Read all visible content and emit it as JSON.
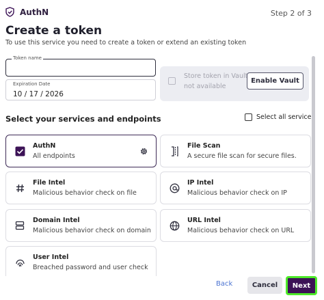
{
  "header": {
    "brand": "AuthN",
    "step": "Step 2 of 3"
  },
  "page": {
    "title": "Create a token",
    "subtitle": "To use this service you need to create a token or extend an existing token"
  },
  "form": {
    "token_name_label": "Token name",
    "token_name_value": "",
    "expiration_label": "Expiration Date",
    "expiration_value": "10 / 17 / 2026",
    "store_token_text": "Store token in Vault not available",
    "enable_vault_label": "Enable Vault"
  },
  "services": {
    "section_title": "Select your services and endpoints",
    "select_all_label": "Select all services",
    "items": [
      {
        "name": "AuthN",
        "desc": "All endpoints",
        "icon": "check-square-icon",
        "selected": true
      },
      {
        "name": "File Scan",
        "desc": "A secure file scan for secure files.",
        "icon": "file-scan-icon",
        "selected": false
      },
      {
        "name": "File Intel",
        "desc": "Malicious behavior check on file",
        "icon": "hash-icon",
        "selected": false
      },
      {
        "name": "IP Intel",
        "desc": "Malicious behavior check on IP",
        "icon": "ip-icon",
        "selected": false
      },
      {
        "name": "Domain Intel",
        "desc": "Malicious behavior check on domain",
        "icon": "server-icon",
        "selected": false
      },
      {
        "name": "URL Intel",
        "desc": "Malicious behavior check on URL",
        "icon": "globe-icon",
        "selected": false
      },
      {
        "name": "User Intel",
        "desc": "Breached password and user check",
        "icon": "fingerprint-icon",
        "selected": false
      }
    ]
  },
  "footer": {
    "back_label": "Back",
    "cancel_label": "Cancel",
    "next_label": "Next"
  },
  "colors": {
    "brand_purple": "#3c1256",
    "next_highlight": "#4eea2a",
    "link_blue": "#4b73d1"
  }
}
